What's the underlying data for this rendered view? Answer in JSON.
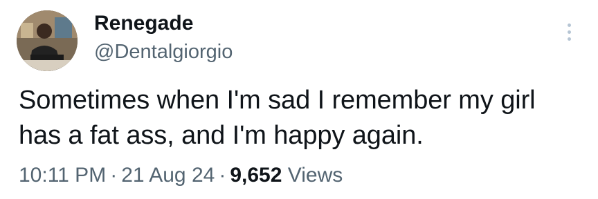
{
  "author": {
    "display_name": "Renegade",
    "handle": "@Dentalgiorgio",
    "avatar": "avatar-photo"
  },
  "menu_icon": "more-vertical-icon",
  "tweet": {
    "lines": [
      "Sometimes when I'm sad I remember my girl",
      "has a fat ass, and I'm happy again."
    ]
  },
  "meta": {
    "time": "10:11 PM",
    "separator": "·",
    "date": "21 Aug 24",
    "views_count": "9,652",
    "views_label": "Views"
  },
  "colors": {
    "primary_text": "#0f1419",
    "secondary_text": "#536471",
    "menu_dots": "#b6c5d4"
  }
}
